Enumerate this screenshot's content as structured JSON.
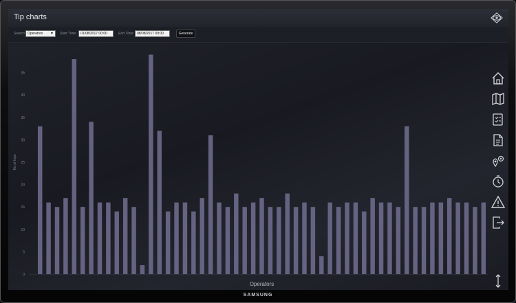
{
  "app": {
    "title": "Tip charts"
  },
  "toolbar": {
    "search_label": "Search",
    "search_value": "Operators",
    "start_label": "Start Time:",
    "start_value": "01/08/2017 00:00",
    "end_label": "End Time:",
    "end_value": "08/08/2017 09:00",
    "generate_label": "Generate"
  },
  "device": {
    "brand": "SAMSUNG"
  },
  "icons": [
    "eye-icon",
    "home-icon",
    "map-icon",
    "checklist-icon",
    "report-icon",
    "location-settings-icon",
    "timer-icon",
    "warning-icon",
    "exit-icon",
    "resize-vertical-icon"
  ],
  "colors": {
    "bar": "#6e6a8c",
    "axis_text": "#7f8290",
    "background": "#15161c"
  },
  "chart_data": {
    "type": "bar",
    "xlabel": "Operators",
    "ylabel": "No of trips",
    "ylim": [
      0,
      50
    ],
    "yticks": [
      0,
      5,
      10,
      15,
      20,
      25,
      30,
      35,
      40,
      45
    ],
    "values": [
      33,
      16,
      15,
      17,
      48,
      15,
      34,
      16,
      16,
      14,
      17,
      15,
      2,
      49,
      32,
      14,
      16,
      16,
      14,
      17,
      31,
      16,
      15,
      18,
      15,
      16,
      17,
      15,
      15,
      18,
      15,
      16,
      15,
      4,
      16,
      15,
      16,
      16,
      14,
      17,
      16,
      16,
      15,
      33,
      15,
      15,
      16,
      16,
      17,
      16,
      16,
      15,
      16
    ]
  }
}
